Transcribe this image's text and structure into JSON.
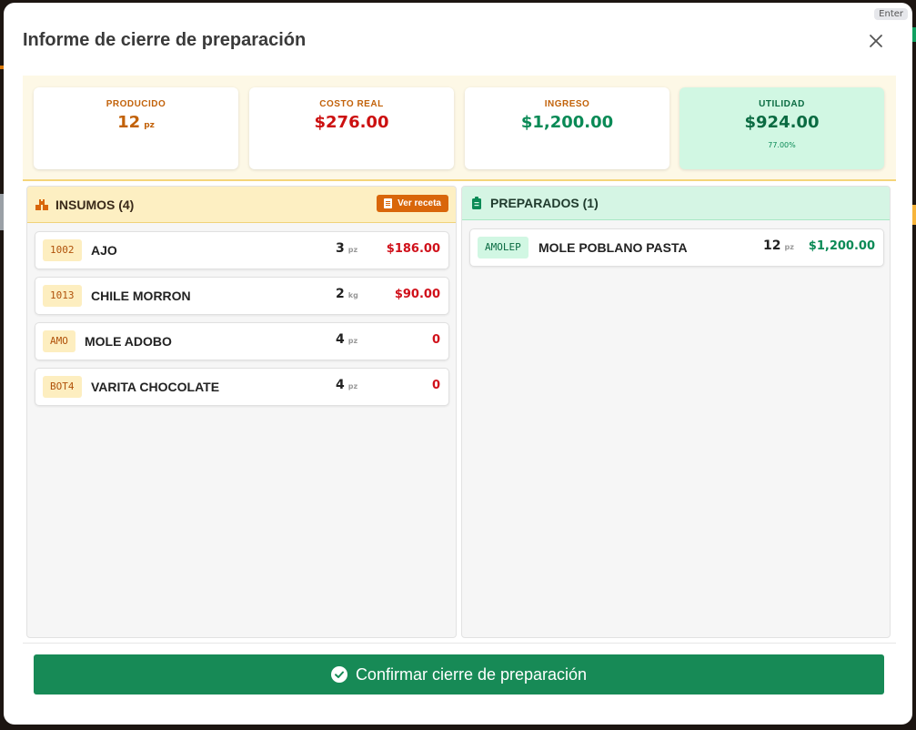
{
  "shortcut_badge": "Enter",
  "title": "Informe de cierre de preparación",
  "summary": {
    "produced": {
      "label": "PRODUCIDO",
      "value": "12",
      "unit": "pz"
    },
    "cost": {
      "label": "COSTO REAL",
      "value": "$276.00"
    },
    "income": {
      "label": "INGRESO",
      "value": "$1,200.00"
    },
    "profit": {
      "label": "UTILIDAD",
      "value": "$924.00",
      "percent": "77.00%"
    }
  },
  "inputs": {
    "heading": "INSUMOS (4)",
    "recipe_button": "Ver receta",
    "items": [
      {
        "code": "1002",
        "name": "AJO",
        "qty": "3",
        "unit": "pz",
        "amount": "$186.00"
      },
      {
        "code": "1013",
        "name": "CHILE MORRON",
        "qty": "2",
        "unit": "kg",
        "amount": "$90.00"
      },
      {
        "code": "AMO",
        "name": "MOLE ADOBO",
        "qty": "4",
        "unit": "pz",
        "amount": "0"
      },
      {
        "code": "BOT4",
        "name": "VARITA CHOCOLATE",
        "qty": "4",
        "unit": "pz",
        "amount": "0"
      }
    ]
  },
  "outputs": {
    "heading": "PREPARADOS (1)",
    "items": [
      {
        "code": "AMOLEP",
        "name": "MOLE POBLANO PASTA",
        "qty": "12",
        "unit": "pz",
        "amount": "$1,200.00"
      }
    ]
  },
  "confirm_label": "Confirmar cierre de preparación",
  "colors": {
    "primary_green": "#178a56",
    "accent_orange": "#d9660a",
    "cost_red": "#cc1010"
  }
}
